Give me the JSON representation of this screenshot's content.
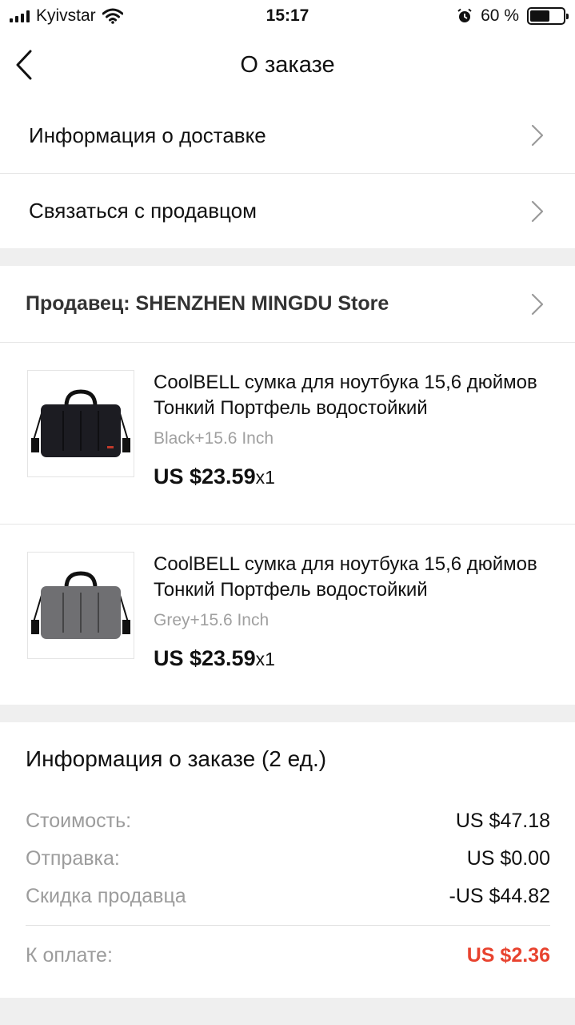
{
  "status_bar": {
    "carrier": "Kyivstar",
    "time": "15:17",
    "battery_text": "60 %",
    "battery_level": 0.6
  },
  "nav": {
    "title": "О заказе"
  },
  "links": {
    "delivery": "Информация о доставке",
    "contact": "Связаться с продавцом"
  },
  "seller": {
    "label": "Продавец: SHENZHEN MINGDU Store"
  },
  "items": [
    {
      "title": "CoolBELL сумка для ноутбука 15,6 дюймов Тонкий Портфель водостойкий",
      "variant": "Black+15.6 Inch",
      "price": "US $23.59",
      "qty": "x1",
      "color": "#1c1c22"
    },
    {
      "title": "CoolBELL сумка для ноутбука 15,6 дюймов Тонкий Портфель водостойкий",
      "variant": "Grey+15.6 Inch",
      "price": "US $23.59",
      "qty": "x1",
      "color": "#6f6f72"
    }
  ],
  "summary": {
    "title": "Информация о заказе (2 ед.)",
    "cost_label": "Стоимость:",
    "cost_value": "US $47.18",
    "shipping_label": "Отправка:",
    "shipping_value": "US $0.00",
    "discount_label": "Скидка продавца",
    "discount_value": "-US $44.82",
    "total_label": "К оплате:",
    "total_value": "US $2.36",
    "total_color": "#e8432f"
  }
}
